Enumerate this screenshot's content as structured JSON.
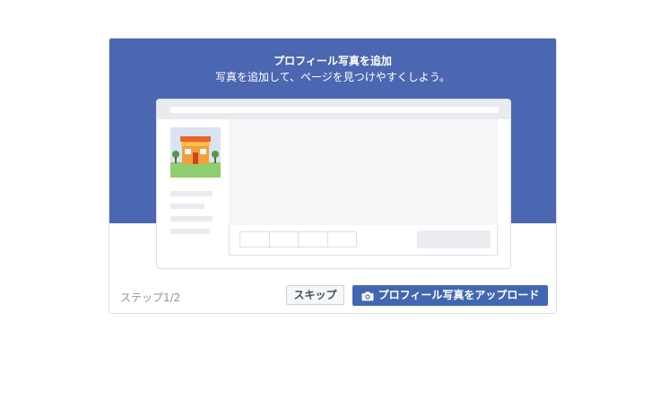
{
  "dialog": {
    "title": "プロフィール写真を追加",
    "subtitle": "写真を追加して、ページを見つけやすくしよう。"
  },
  "illustration": {
    "profile_icon": "storefront-illustration",
    "hero_color": "#4c67b1"
  },
  "footer": {
    "step_label": "ステップ1/2",
    "skip_label": "スキップ",
    "upload_label": "プロフィール写真をアップロード",
    "upload_icon": "camera-icon",
    "accent": "#4267b2"
  }
}
